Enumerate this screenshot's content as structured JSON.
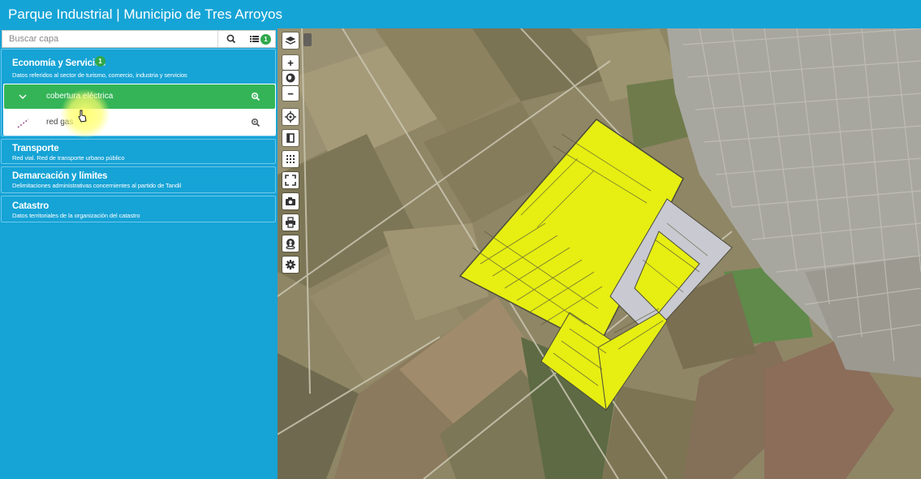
{
  "header": {
    "title": "Parque Industrial | Municipio de Tres Arroyos"
  },
  "search": {
    "placeholder": "Buscar capa",
    "active_count": "1"
  },
  "groups": [
    {
      "title": "Economía y Servicios",
      "badge": "1",
      "description": "Datos referidos al sector de turismo, comercio, industria y servicios"
    },
    {
      "title": "Transporte",
      "description": "Red vial. Red de transporte urbano público"
    },
    {
      "title": "Demarcación y límites",
      "description": "Delimitaciones administrativas concernientes al partido de Tandil"
    },
    {
      "title": "Catastro",
      "description": "Datos territoriales de la organización del catastro"
    }
  ],
  "layers": [
    {
      "label": "cobertura eléctrica",
      "active": true
    },
    {
      "label": "red gas",
      "active": false
    }
  ],
  "toolbar": [
    {
      "icon": "layers-icon"
    },
    {
      "icon": "zoom-in-icon",
      "label": "+"
    },
    {
      "icon": "globe-icon"
    },
    {
      "icon": "zoom-out-icon",
      "label": "−"
    },
    {
      "icon": "locate-icon"
    },
    {
      "icon": "book-icon"
    },
    {
      "icon": "grid-icon"
    },
    {
      "icon": "fullscreen-icon"
    },
    {
      "icon": "camera-icon"
    },
    {
      "icon": "print-icon"
    },
    {
      "icon": "street-view-icon"
    },
    {
      "icon": "settings-icon"
    }
  ],
  "colors": {
    "header": "#15a4d6",
    "sidebar": "#16a3d6",
    "active_layer": "#34b457",
    "badge": "#2ea84a",
    "parcel_fill": "#e6ee12",
    "parcel_free": "#c9c9d1"
  }
}
